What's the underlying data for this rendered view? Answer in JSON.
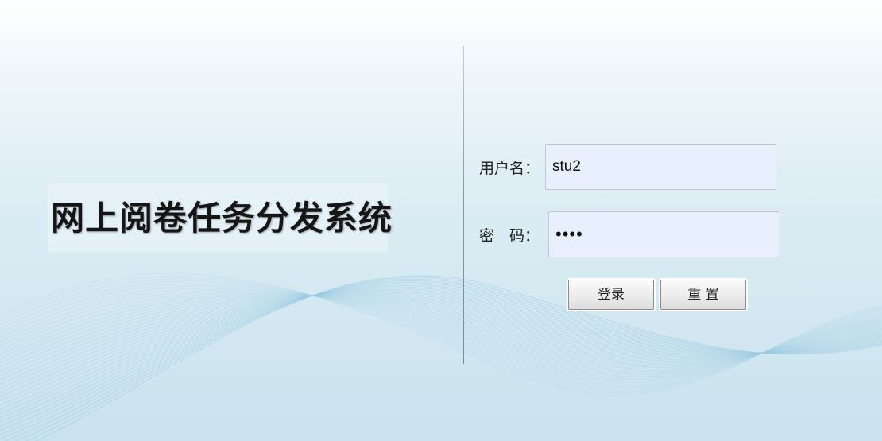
{
  "app": {
    "title": "网上阅卷任务分发系统"
  },
  "login_form": {
    "username_label": "用户名：",
    "username_value": "stu2",
    "password_label": "密　码：",
    "password_value": "••••",
    "login_button": "登录",
    "reset_button": "重 置"
  },
  "colors": {
    "input_background": "#e8f0fd",
    "page_background_top": "#ffffff",
    "page_background_bottom": "#c9e2ee",
    "wave_lines": "#9ccbe3"
  }
}
